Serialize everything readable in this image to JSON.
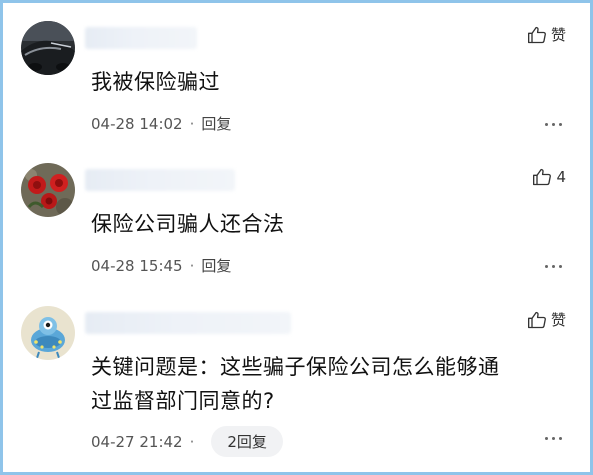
{
  "comments": [
    {
      "avatar": "car-photo-avatar",
      "like_label": "赞",
      "text": "我被保险骗过",
      "time": "04-28 14:02",
      "separator": "·",
      "reply": "回复"
    },
    {
      "avatar": "red-flowers-avatar",
      "like_label": "4",
      "text": "保险公司骗人还合法",
      "time": "04-28 15:45",
      "separator": "·",
      "reply": "回复"
    },
    {
      "avatar": "cartoon-character-avatar",
      "like_label": "赞",
      "text_line1": "关键问题是：这些骗子保险公司怎么能够通",
      "text_line2": "过监督部门同意的?",
      "time": "04-27 21:42",
      "separator": "·",
      "reply": "2回复"
    }
  ],
  "colors": {
    "border": "#8fc4ea",
    "text": "#111111",
    "meta": "#555555",
    "reply_pill_bg": "#f1f2f4"
  }
}
